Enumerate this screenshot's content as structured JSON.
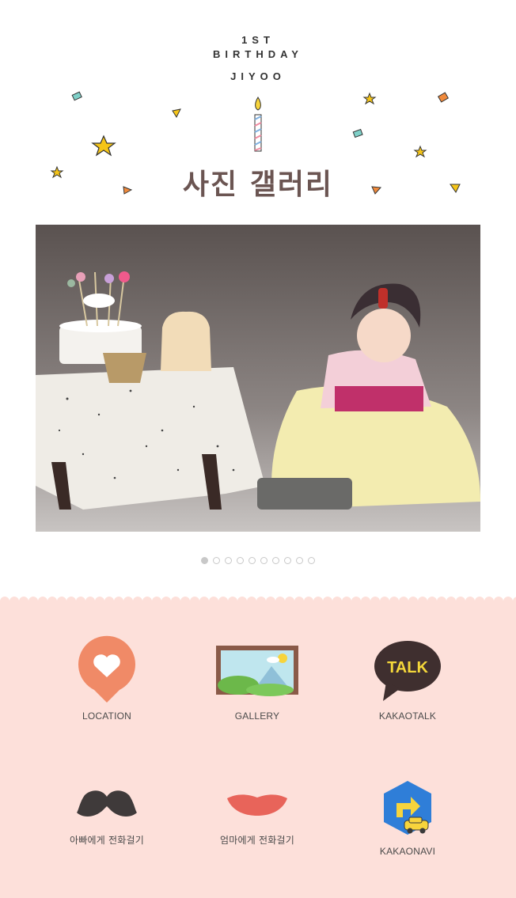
{
  "header": {
    "line1": "1ST",
    "line2": "BIRTHDAY",
    "name": "JIYOO",
    "gallery_title": "사진 갤러리"
  },
  "carousel": {
    "total_slides": 10,
    "active_index": 0
  },
  "menu": [
    {
      "id": "location",
      "label": "LOCATION",
      "icon": "heart-pin-icon"
    },
    {
      "id": "gallery",
      "label": "GALLERY",
      "icon": "landscape-picture-icon"
    },
    {
      "id": "kakaotalk",
      "label": "KAKAOTALK",
      "icon": "talk-bubble-icon",
      "icon_text": "TALK"
    },
    {
      "id": "call-dad",
      "label": "아빠에게 전화걸기",
      "icon": "mustache-icon"
    },
    {
      "id": "call-mom",
      "label": "엄마에게 전화걸기",
      "icon": "lips-icon"
    },
    {
      "id": "kakaonavi",
      "label": "KAKAONAVI",
      "icon": "navi-car-icon"
    }
  ],
  "colors": {
    "bottom_background": "#fde0da",
    "title_color": "#6b5552",
    "location_icon": "#f08a67",
    "lips_icon": "#e8645a",
    "mustache_icon": "#3f3a3a",
    "talk_bubble": "#3f2f2f",
    "talk_text": "#f5d83a",
    "navi_blue": "#2f7ed8",
    "navi_yellow": "#f7d43c"
  }
}
